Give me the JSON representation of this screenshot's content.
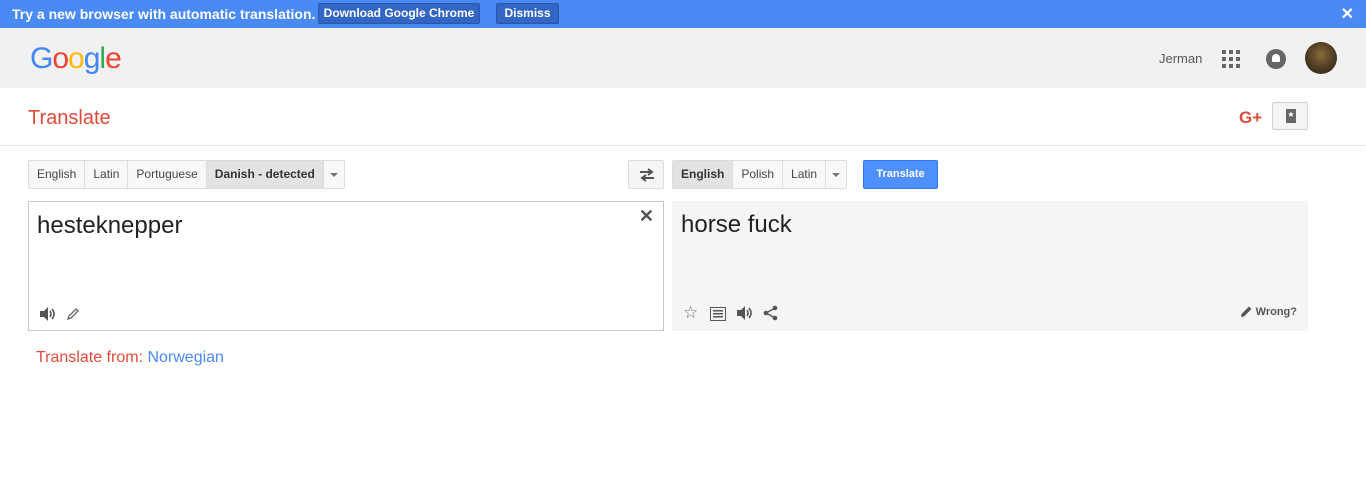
{
  "promo": {
    "text": "Try a new browser with automatic translation.",
    "download_label": "Download Google Chrome",
    "dismiss_label": "Dismiss",
    "close_glyph": "✕"
  },
  "header": {
    "logo_letters": [
      {
        "ch": "G",
        "color": "#4285f4"
      },
      {
        "ch": "o",
        "color": "#ea4335"
      },
      {
        "ch": "o",
        "color": "#fbbc05"
      },
      {
        "ch": "g",
        "color": "#4285f4"
      },
      {
        "ch": "l",
        "color": "#34a853"
      },
      {
        "ch": "e",
        "color": "#ea4335"
      }
    ],
    "username": "Jerman",
    "icons": [
      "apps-grid-icon",
      "notifications-bell-icon",
      "avatar"
    ]
  },
  "subheader": {
    "title": "Translate",
    "gplus_label": "G+"
  },
  "source": {
    "languages": [
      {
        "label": "English",
        "active": false
      },
      {
        "label": "Latin",
        "active": false
      },
      {
        "label": "Portuguese",
        "active": false
      },
      {
        "label": "Danish - detected",
        "active": true
      }
    ],
    "text": "hesteknepper",
    "clear_glyph": "✕"
  },
  "target": {
    "languages": [
      {
        "label": "English",
        "active": true
      },
      {
        "label": "Polish",
        "active": false
      },
      {
        "label": "Latin",
        "active": false
      }
    ],
    "text": "horse fuck",
    "star_glyph": "☆",
    "wrong_label": "Wrong?"
  },
  "translate_button": "Translate",
  "suggestion": {
    "prefix": "Translate from:",
    "language": "Norwegian"
  },
  "colors": {
    "promo_bg": "#4a8af4",
    "accent_red": "#dd4b39",
    "link_blue": "#4a8af4",
    "button_blue": "#4d90fe"
  }
}
